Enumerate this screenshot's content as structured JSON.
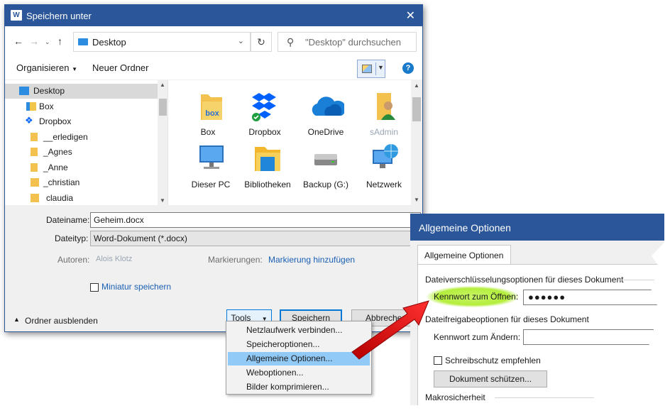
{
  "save_dialog": {
    "title": "Speichern unter",
    "app_icon": "word-icon",
    "address": "Desktop",
    "search_placeholder": "\"Desktop\" durchsuchen",
    "toolbar": {
      "organize": "Organisieren",
      "new_folder": "Neuer Ordner"
    },
    "nav_items": [
      {
        "label": "Desktop",
        "icon": "desktop-icon",
        "selected": true
      },
      {
        "label": "Box",
        "icon": "box-icon"
      },
      {
        "label": "Dropbox",
        "icon": "dropbox-icon"
      },
      {
        "label": "__erledigen",
        "icon": "folder-icon"
      },
      {
        "label": "_Agnes",
        "icon": "folder-icon"
      },
      {
        "label": "_Anne",
        "icon": "folder-icon"
      },
      {
        "label": "_christian",
        "icon": "folder-icon"
      },
      {
        "label": "claudia",
        "icon": "folder-icon"
      }
    ],
    "files": [
      {
        "label": "Box",
        "icon": "box-folder-icon"
      },
      {
        "label": "Dropbox",
        "icon": "dropbox-icon"
      },
      {
        "label": "OneDrive",
        "icon": "onedrive-cloud-icon"
      },
      {
        "label": "sAdmin",
        "icon": "user-folder-icon"
      },
      {
        "label": "Dieser PC",
        "icon": "computer-icon"
      },
      {
        "label": "Bibliotheken",
        "icon": "libraries-icon"
      },
      {
        "label": "Backup (G:)",
        "icon": "drive-icon"
      },
      {
        "label": "Netzwerk",
        "icon": "network-icon"
      }
    ],
    "filename_label": "Dateiname:",
    "filename_value": "Geheim.docx",
    "filetype_label": "Dateityp:",
    "filetype_value": "Word-Dokument (*.docx)",
    "authors_label": "Autoren:",
    "authors_value": "Alois Klotz",
    "tags_label": "Markierungen:",
    "tags_value": "Markierung hinzufügen",
    "thumbnail_label": "Miniatur speichern",
    "hide_folders": "Ordner ausblenden",
    "tools_button": "Tools",
    "save_button": "Speichern",
    "cancel_button": "Abbrechen"
  },
  "tools_menu": {
    "items": [
      {
        "label": "Netzlaufwerk verbinden..."
      },
      {
        "label": "Speicheroptionen..."
      },
      {
        "label": "Allgemeine Optionen...",
        "highlighted": true
      },
      {
        "label": "Weboptionen..."
      },
      {
        "label": "Bilder komprimieren..."
      }
    ]
  },
  "options_dialog": {
    "title": "Allgemeine Optionen",
    "tab": "Allgemeine Optionen",
    "encryption_section": "Dateiverschlüsselungsoptionen für dieses Dokument",
    "open_password_label": "Kennwort zum Öffnen:",
    "open_password_value": "●●●●●●",
    "sharing_section": "Dateifreigabeoptionen für dieses Dokument",
    "modify_password_label": "Kennwort zum Ändern:",
    "read_only_label": "Schreibschutz empfehlen",
    "protect_button": "Dokument schützen...",
    "macro_section": "Makrosicherheit"
  },
  "colors": {
    "title_bar": "#2b579a",
    "highlight_glow": "#b4ee3c",
    "arrow": "#e02020",
    "menu_highlight": "#91c9f7"
  }
}
